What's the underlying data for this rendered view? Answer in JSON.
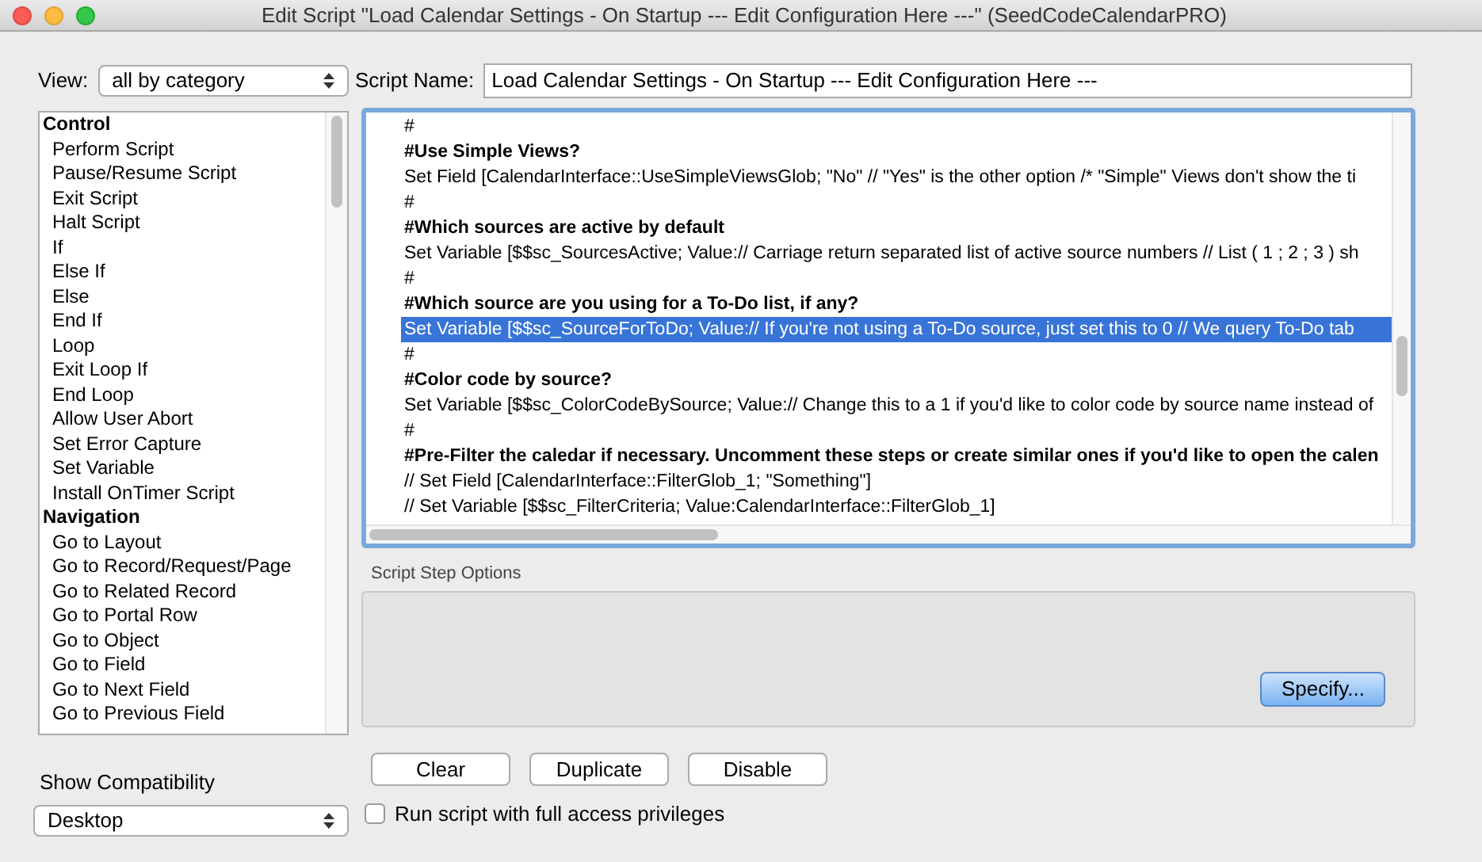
{
  "window": {
    "title": "Edit Script \"Load Calendar Settings - On Startup --- Edit Configuration Here ---\" (SeedCodeCalendarPRO)"
  },
  "view": {
    "label": "View:",
    "value": "all by category"
  },
  "script_name": {
    "label": "Script Name:",
    "value": "Load Calendar Settings - On Startup --- Edit Configuration Here ---"
  },
  "steps": [
    {
      "kind": "category",
      "label": "Control"
    },
    {
      "kind": "step",
      "label": "Perform Script"
    },
    {
      "kind": "step",
      "label": "Pause/Resume Script"
    },
    {
      "kind": "step",
      "label": "Exit Script"
    },
    {
      "kind": "step",
      "label": "Halt Script"
    },
    {
      "kind": "step",
      "label": "If"
    },
    {
      "kind": "step",
      "label": "Else If"
    },
    {
      "kind": "step",
      "label": "Else"
    },
    {
      "kind": "step",
      "label": "End If"
    },
    {
      "kind": "step",
      "label": "Loop"
    },
    {
      "kind": "step",
      "label": "Exit Loop If"
    },
    {
      "kind": "step",
      "label": "End Loop"
    },
    {
      "kind": "step",
      "label": "Allow User Abort"
    },
    {
      "kind": "step",
      "label": "Set Error Capture"
    },
    {
      "kind": "step",
      "label": "Set Variable"
    },
    {
      "kind": "step",
      "label": "Install OnTimer Script"
    },
    {
      "kind": "category",
      "label": "Navigation"
    },
    {
      "kind": "step",
      "label": "Go to Layout"
    },
    {
      "kind": "step",
      "label": "Go to Record/Request/Page"
    },
    {
      "kind": "step",
      "label": "Go to Related Record"
    },
    {
      "kind": "step",
      "label": "Go to Portal Row"
    },
    {
      "kind": "step",
      "label": "Go to Object"
    },
    {
      "kind": "step",
      "label": "Go to Field"
    },
    {
      "kind": "step",
      "label": "Go to Next Field"
    },
    {
      "kind": "step",
      "label": "Go to Previous Field"
    }
  ],
  "script_lines": [
    {
      "kind": "comment",
      "text": "#",
      "selected": false
    },
    {
      "kind": "heading",
      "text": "#Use Simple Views?",
      "selected": false
    },
    {
      "kind": "step",
      "text": "Set Field [CalendarInterface::UseSimpleViewsGlob; \"No\" // \"Yes\" is the other option  /*  \"Simple\" Views don't show the ti",
      "selected": false
    },
    {
      "kind": "comment",
      "text": "#",
      "selected": false
    },
    {
      "kind": "heading",
      "text": "#Which sources are active by default",
      "selected": false
    },
    {
      "kind": "step",
      "text": "Set Variable [$$sc_SourcesActive; Value:// Carriage return separated list of active source numbers // List ( 1 ; 2 ; 3 ) sh",
      "selected": false
    },
    {
      "kind": "comment",
      "text": "#",
      "selected": false
    },
    {
      "kind": "heading",
      "text": "#Which source are you using for a To-Do list, if any?",
      "selected": false
    },
    {
      "kind": "step",
      "text": "Set Variable [$$sc_SourceForToDo; Value:// If you're not using a To-Do source, just set this to 0 // We query To-Do tab",
      "selected": true
    },
    {
      "kind": "comment",
      "text": "#",
      "selected": false
    },
    {
      "kind": "heading",
      "text": "#Color code by source?",
      "selected": false
    },
    {
      "kind": "step",
      "text": "Set Variable [$$sc_ColorCodeBySource; Value:// Change this to a 1 if you'd like to color code by source name instead of",
      "selected": false
    },
    {
      "kind": "comment",
      "text": "#",
      "selected": false
    },
    {
      "kind": "heading",
      "text": "#Pre-Filter the caledar if necessary. Uncomment these steps or create similar ones if you'd like to open the calen",
      "selected": false
    },
    {
      "kind": "step",
      "text": "//  Set Field [CalendarInterface::FilterGlob_1; \"Something\"]",
      "selected": false
    },
    {
      "kind": "step",
      "text": "//  Set Variable [$$sc_FilterCriteria; Value:CalendarInterface::FilterGlob_1]",
      "selected": false
    }
  ],
  "step_options": {
    "title": "Script Step Options",
    "button": "Specify..."
  },
  "actions": [
    "Clear",
    "Duplicate",
    "Disable"
  ],
  "compatibility": {
    "label": "Show Compatibility",
    "value": "Desktop"
  },
  "full_access": {
    "label": "Run script with full access privileges",
    "checked": false
  }
}
